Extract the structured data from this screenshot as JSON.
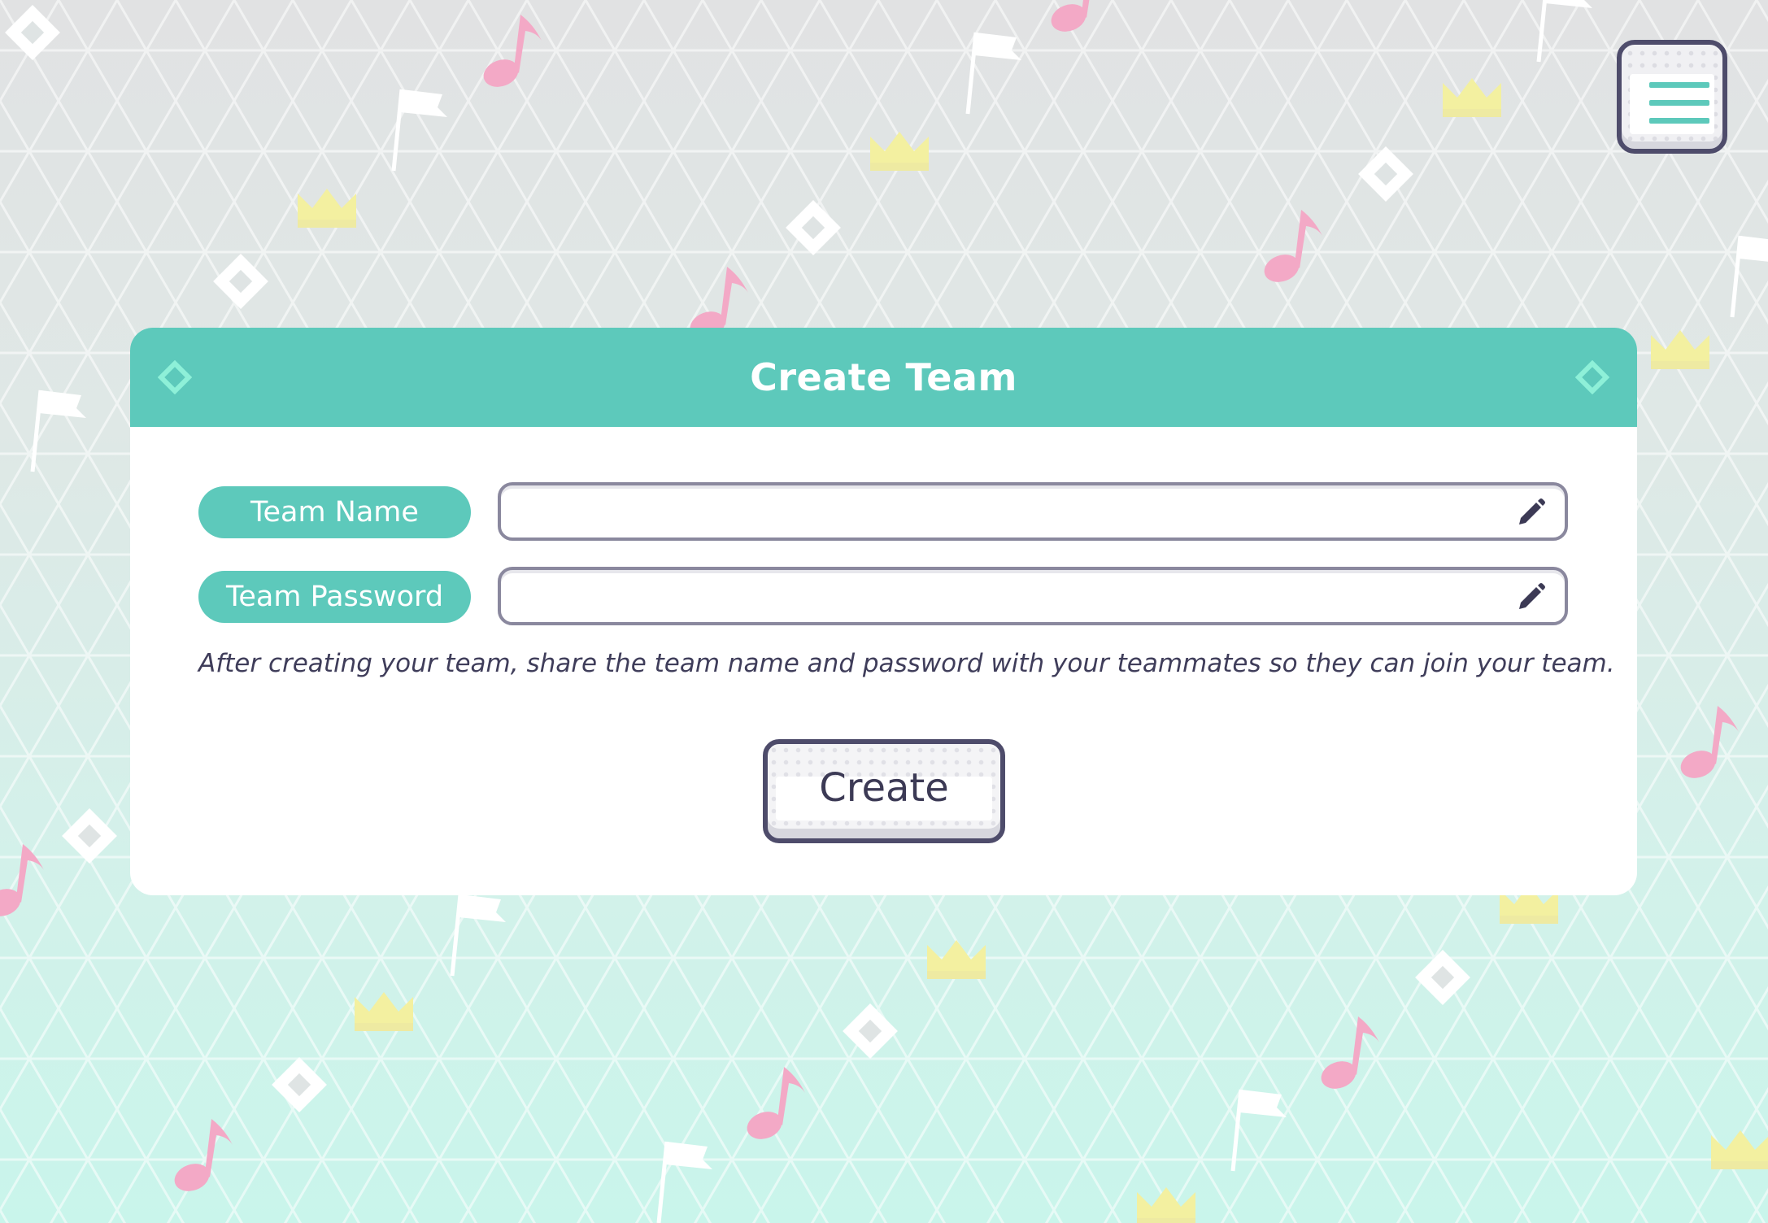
{
  "menu": {
    "icon": "hamburger-menu-icon"
  },
  "dialog": {
    "title": "Create Team",
    "header_icon": "diamond-icon",
    "fields": [
      {
        "label": "Team Name",
        "value": "",
        "icon": "pencil-icon"
      },
      {
        "label": "Team Password",
        "value": "",
        "icon": "pencil-icon"
      }
    ],
    "note": "After creating your team, share the team name and password with your teammates so they can join your team.",
    "create_label": "Create"
  },
  "colors": {
    "accent": "#5dc9bb",
    "button_border": "#4e4c6b",
    "text": "#3c3a55",
    "note_pink": "#f3a9c6",
    "crown_yellow": "#f3f0a0"
  }
}
